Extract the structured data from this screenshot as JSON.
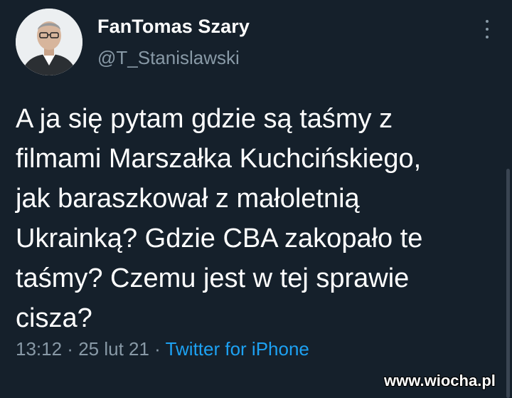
{
  "author": {
    "display_name": "FanTomas Szary",
    "handle": "@T_Stanislawski",
    "avatar_icon": "profile-photo"
  },
  "menu_icon": "more-vertical-icon",
  "tweet": {
    "lines": [
      "A ja się pytam gdzie są taśmy z",
      "filmami Marszałka Kuchcińskiego,",
      "jak baraszkował z małoletnią",
      "Ukrainką? Gdzie CBA zakopało te",
      "taśmy? Czemu jest w tej sprawie",
      "cisza?"
    ]
  },
  "meta": {
    "time": "13:12",
    "separator": " · ",
    "date": "25 lut 21",
    "source": "Twitter for iPhone"
  },
  "watermark": "www.wiocha.pl",
  "colors": {
    "background": "#15202b",
    "secondary_text": "#8899a6",
    "link": "#1da1f2"
  }
}
